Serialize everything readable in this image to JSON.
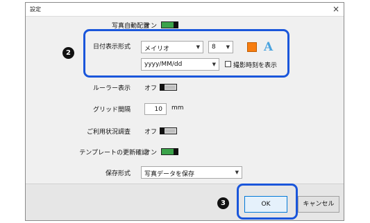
{
  "window": {
    "title": "設定",
    "close_glyph": "×"
  },
  "settings": {
    "auto_layout": {
      "label": "写真自動配置",
      "state": "オン"
    },
    "date_format": {
      "label": "日付表示形式",
      "font": "メイリオ",
      "size": "8",
      "format": "yyyy/MM/dd",
      "show_time_label": "撮影時刻を表示",
      "color": "#f77d0f",
      "font_style_glyph": "A"
    },
    "ruler": {
      "label": "ルーラー表示",
      "state": "オフ"
    },
    "grid": {
      "label": "グリッド間隔",
      "value": "10",
      "unit": "mm"
    },
    "usage": {
      "label": "ご利用状況調査",
      "state": "オフ"
    },
    "template_update": {
      "label": "テンプレートの更新確認",
      "state": "オン"
    },
    "save_format": {
      "label": "保存形式",
      "value": "写真データを保存"
    }
  },
  "footer": {
    "ok": "OK",
    "cancel": "キャンセル"
  },
  "callouts": {
    "date": "2",
    "ok": "3"
  },
  "colors": {
    "accent": "#1a56db",
    "toggle_on": "#3ba34a"
  }
}
